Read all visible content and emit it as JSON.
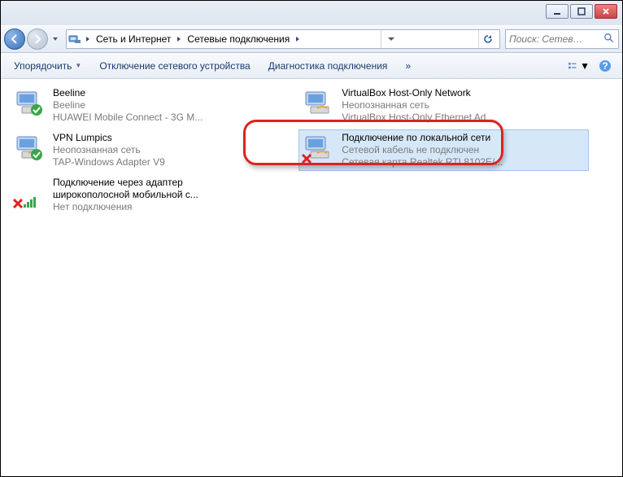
{
  "titlebar": {
    "min": "_",
    "max": "□",
    "close": "×"
  },
  "breadcrumb": {
    "seg1": "Сеть и Интернет",
    "seg2": "Сетевые подключения"
  },
  "search": {
    "placeholder": "Поиск: Сетев…"
  },
  "toolbar": {
    "organize": "Упорядочить",
    "disable": "Отключение сетевого устройства",
    "diagnose": "Диагностика подключения",
    "more": "»"
  },
  "items": [
    {
      "l1": "Beeline",
      "l2": "Beeline",
      "l3": "HUAWEI Mobile Connect - 3G M..."
    },
    {
      "l1": "VPN Lumpics",
      "l2": "Неопознанная сеть",
      "l3": "TAP-Windows Adapter V9"
    },
    {
      "l1": "Подключение через адаптер",
      "l2": "широкополосной мобильной с...",
      "l3": "Нет подключения"
    },
    {
      "l1": "VirtualBox Host-Only Network",
      "l2": "Неопознанная сеть",
      "l3": "VirtualBox Host-Only Ethernet Ad..."
    },
    {
      "l1": "Подключение по локальной сети",
      "l2": "Сетевой кабель не подключен",
      "l3": "Сетевая карта Realtek RTL8102E/..."
    }
  ]
}
